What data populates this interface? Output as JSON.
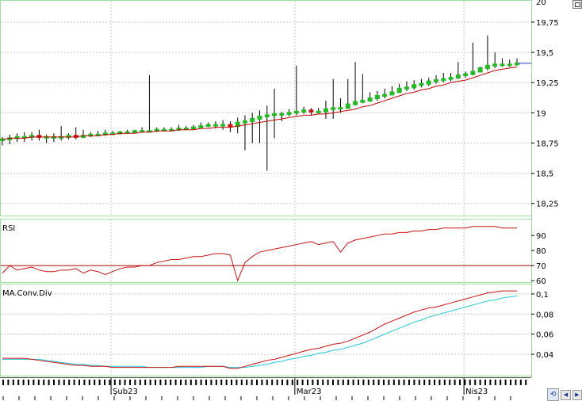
{
  "colors": {
    "panel_border": "#9adf9a",
    "grid": "#c8c8c8",
    "price_ma": "#c00000",
    "candle_up": "#22bb22",
    "candle_down": "#cc1111",
    "wick": "#000000",
    "rsi_line": "#cc1111",
    "rsi_threshold": "#aa0000",
    "macd_line": "#cc1111",
    "signal_line": "#22c8e0",
    "last_price_marker": "#2233cc"
  },
  "icons": {
    "corner": "maximize-icon",
    "nav": [
      "refresh-icon",
      "arrow-left-icon",
      "arrow-right-icon"
    ]
  },
  "chart_data": [
    {
      "type": "candlestick",
      "panel": "price",
      "ylim": [
        18.15,
        19.92
      ],
      "yticks": [
        "18,25",
        "18,5",
        "18,75",
        "19",
        "19,25",
        "19,5",
        "19,75"
      ],
      "ytick_values": [
        18.25,
        18.5,
        18.75,
        19.0,
        19.25,
        19.5,
        19.75
      ],
      "top_partial_tick": "20",
      "grid": true,
      "x_sessions": 72,
      "close": [
        18.78,
        18.79,
        18.8,
        18.8,
        18.81,
        18.8,
        18.8,
        18.8,
        18.8,
        18.81,
        18.8,
        18.81,
        18.82,
        18.82,
        18.83,
        18.83,
        18.84,
        18.84,
        18.85,
        18.85,
        18.85,
        18.86,
        18.86,
        18.86,
        18.87,
        18.87,
        18.88,
        18.89,
        18.9,
        18.9,
        18.9,
        18.89,
        18.92,
        18.93,
        18.95,
        18.97,
        18.98,
        18.99,
        18.99,
        19.0,
        19.01,
        19.02,
        19.01,
        19.01,
        19.03,
        19.04,
        19.04,
        19.07,
        19.09,
        19.1,
        19.12,
        19.14,
        19.15,
        19.17,
        19.2,
        19.21,
        19.23,
        19.24,
        19.26,
        19.27,
        19.28,
        19.29,
        19.31,
        19.32,
        19.34,
        19.37,
        19.39,
        19.4,
        19.4,
        19.4,
        19.41
      ],
      "high": [
        18.8,
        18.82,
        18.83,
        18.84,
        18.84,
        18.86,
        18.82,
        18.83,
        18.89,
        18.83,
        18.88,
        18.86,
        18.84,
        18.85,
        18.86,
        18.85,
        18.85,
        18.86,
        18.86,
        18.88,
        19.31,
        18.88,
        18.88,
        18.88,
        18.9,
        18.89,
        18.9,
        18.92,
        18.92,
        18.93,
        18.94,
        18.93,
        18.96,
        18.98,
        19.0,
        19.02,
        19.06,
        19.2,
        19.01,
        19.03,
        19.39,
        19.05,
        19.04,
        19.04,
        19.1,
        19.28,
        19.12,
        19.28,
        19.42,
        19.32,
        19.17,
        19.18,
        19.2,
        19.22,
        19.24,
        19.26,
        19.27,
        19.28,
        19.29,
        19.31,
        19.33,
        19.33,
        19.42,
        19.34,
        19.58,
        19.38,
        19.64,
        19.5,
        19.45,
        19.44,
        19.45
      ],
      "low": [
        18.73,
        18.74,
        18.76,
        18.76,
        18.77,
        18.77,
        18.75,
        18.76,
        18.77,
        18.78,
        18.78,
        18.79,
        18.8,
        18.81,
        18.81,
        18.82,
        18.82,
        18.83,
        18.83,
        18.84,
        18.84,
        18.84,
        18.85,
        18.85,
        18.85,
        18.86,
        18.86,
        18.87,
        18.88,
        18.87,
        18.86,
        18.84,
        18.83,
        18.69,
        18.75,
        18.75,
        18.52,
        18.79,
        18.93,
        18.97,
        18.98,
        18.99,
        18.98,
        18.99,
        18.95,
        18.95,
        19.0,
        19.04,
        19.06,
        19.08,
        19.09,
        19.1,
        19.12,
        19.15,
        19.17,
        19.18,
        19.19,
        19.21,
        19.22,
        19.24,
        19.25,
        19.26,
        19.28,
        19.29,
        19.31,
        19.34,
        19.35,
        19.37,
        19.38,
        19.38,
        19.39
      ],
      "ma": [
        18.78,
        18.79,
        18.79,
        18.79,
        18.8,
        18.8,
        18.8,
        18.8,
        18.8,
        18.8,
        18.8,
        18.81,
        18.81,
        18.81,
        18.82,
        18.82,
        18.83,
        18.83,
        18.83,
        18.84,
        18.84,
        18.85,
        18.85,
        18.85,
        18.86,
        18.86,
        18.86,
        18.87,
        18.87,
        18.88,
        18.88,
        18.88,
        18.89,
        18.9,
        18.91,
        18.92,
        18.93,
        18.94,
        18.95,
        18.96,
        18.97,
        18.98,
        18.98,
        18.99,
        18.99,
        19.0,
        19.01,
        19.02,
        19.03,
        19.05,
        19.06,
        19.08,
        19.1,
        19.12,
        19.14,
        19.16,
        19.17,
        19.19,
        19.2,
        19.22,
        19.23,
        19.25,
        19.26,
        19.27,
        19.29,
        19.31,
        19.33,
        19.35,
        19.36,
        19.37,
        19.38
      ]
    },
    {
      "type": "line",
      "panel": "rsi",
      "title": "RSI",
      "ylim": [
        59,
        98
      ],
      "yticks": [
        "60",
        "70",
        "80",
        "90"
      ],
      "ytick_values": [
        60,
        70,
        80,
        90
      ],
      "threshold": 70,
      "series": [
        {
          "values": [
            65,
            70,
            67,
            68,
            69,
            67,
            66,
            66,
            67,
            67,
            68,
            65,
            67,
            66,
            64,
            66,
            68,
            69,
            69,
            70,
            70,
            72,
            73,
            74,
            74,
            75,
            76,
            76,
            77,
            78,
            78,
            77,
            60,
            72,
            76,
            79,
            80,
            81,
            82,
            83,
            84,
            85,
            86,
            84,
            85,
            86,
            79,
            85,
            87,
            88,
            89,
            90,
            91,
            91,
            92,
            92,
            93,
            93,
            94,
            94,
            95,
            95,
            95,
            95,
            96,
            96,
            96,
            96,
            95,
            95,
            95
          ]
        }
      ]
    },
    {
      "type": "line",
      "panel": "macd",
      "title": "MA.Conv.Div",
      "ylim": [
        0.018,
        0.107
      ],
      "yticks": [
        "0,04",
        "0,06",
        "0,08",
        "0,1"
      ],
      "ytick_values": [
        0.04,
        0.06,
        0.08,
        0.1
      ],
      "series": [
        {
          "values": [
            0.036,
            0.036,
            0.036,
            0.036,
            0.035,
            0.034,
            0.033,
            0.032,
            0.031,
            0.03,
            0.029,
            0.029,
            0.028,
            0.028,
            0.028,
            0.027,
            0.027,
            0.027,
            0.027,
            0.027,
            0.027,
            0.027,
            0.027,
            0.027,
            0.028,
            0.028,
            0.028,
            0.028,
            0.028,
            0.028,
            0.028,
            0.026,
            0.026,
            0.028,
            0.03,
            0.032,
            0.034,
            0.035,
            0.037,
            0.039,
            0.041,
            0.043,
            0.045,
            0.046,
            0.048,
            0.05,
            0.051,
            0.053,
            0.056,
            0.059,
            0.062,
            0.066,
            0.07,
            0.073,
            0.076,
            0.079,
            0.082,
            0.084,
            0.086,
            0.087,
            0.089,
            0.091,
            0.093,
            0.095,
            0.097,
            0.099,
            0.101,
            0.102,
            0.103,
            0.103,
            0.103
          ]
        },
        {
          "values": [
            0.035,
            0.035,
            0.035,
            0.035,
            0.035,
            0.035,
            0.034,
            0.033,
            0.032,
            0.031,
            0.03,
            0.03,
            0.029,
            0.029,
            0.028,
            0.028,
            0.028,
            0.028,
            0.028,
            0.028,
            0.027,
            0.027,
            0.027,
            0.027,
            0.027,
            0.027,
            0.027,
            0.027,
            0.028,
            0.028,
            0.028,
            0.027,
            0.027,
            0.027,
            0.028,
            0.029,
            0.03,
            0.032,
            0.033,
            0.035,
            0.036,
            0.038,
            0.039,
            0.041,
            0.042,
            0.044,
            0.045,
            0.047,
            0.049,
            0.051,
            0.054,
            0.057,
            0.06,
            0.063,
            0.066,
            0.069,
            0.072,
            0.074,
            0.077,
            0.079,
            0.081,
            0.083,
            0.085,
            0.087,
            0.089,
            0.091,
            0.093,
            0.094,
            0.096,
            0.097,
            0.098
          ]
        }
      ]
    }
  ],
  "x_axis": {
    "labels": [
      {
        "text": "Şub23",
        "session": 15
      },
      {
        "text": "Mar23",
        "session": 40
      },
      {
        "text": "Nis23",
        "session": 63
      }
    ]
  }
}
